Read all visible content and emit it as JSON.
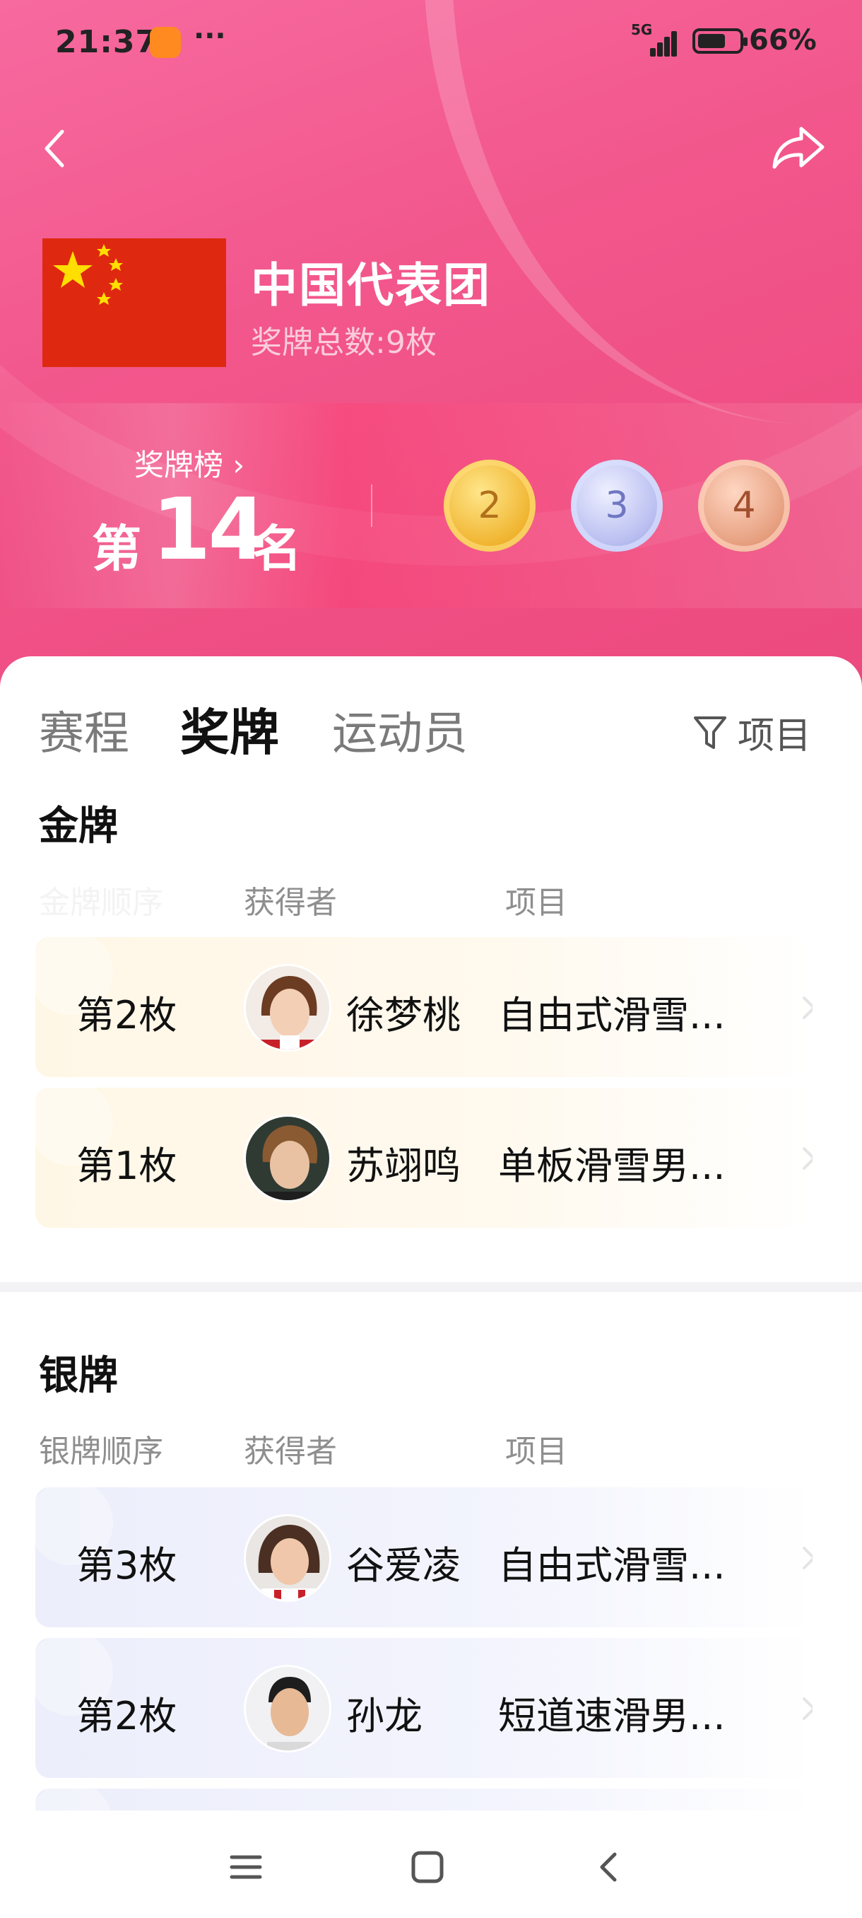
{
  "status_bar": {
    "time": "21:37",
    "network": "5G",
    "battery": "66%"
  },
  "header": {
    "team_name": "中国代表团",
    "medal_total": "奖牌总数:9枚",
    "rank_link": "奖牌榜",
    "rank_prefix": "第",
    "rank_number": "14",
    "rank_suffix": "名",
    "medals": {
      "gold": "2",
      "silver": "3",
      "bronze": "4"
    },
    "colors": {
      "gold": "#f0b531",
      "silver": "#b8bdf0",
      "bronze": "#e69f7f",
      "hero": "#f2578c",
      "flag": "#de2910"
    }
  },
  "tabs": [
    {
      "label": "赛程"
    },
    {
      "label": "奖牌"
    },
    {
      "label": "运动员"
    }
  ],
  "filter_label": "项目",
  "gold": {
    "title": "金牌",
    "columns": {
      "order": "金牌顺序",
      "winner": "获得者",
      "event": "项目"
    },
    "rows": [
      {
        "order": "第2枚",
        "winner": "徐梦桃",
        "event": "自由式滑雪..."
      },
      {
        "order": "第1枚",
        "winner": "苏翊鸣",
        "event": "单板滑雪男..."
      }
    ]
  },
  "silver": {
    "title": "银牌",
    "columns": {
      "order": "银牌顺序",
      "winner": "获得者",
      "event": "项目"
    },
    "rows": [
      {
        "order": "第3枚",
        "winner": "谷爱凌",
        "event": "自由式滑雪..."
      },
      {
        "order": "第2枚",
        "winner": "孙龙",
        "event": "短道速滑男..."
      }
    ]
  }
}
